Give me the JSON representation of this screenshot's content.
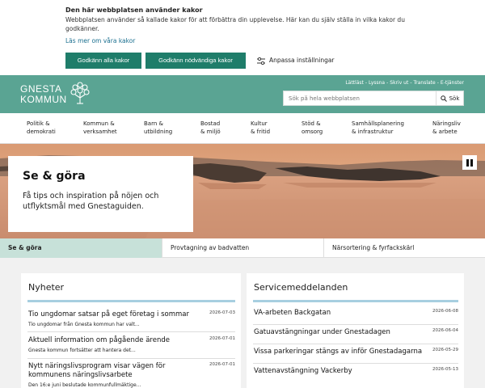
{
  "cookie": {
    "title": "Den här webbplatsen använder kakor",
    "description": "Webbplatsen använder så kallade kakor för att förbättra din upplevelse. Här kan du själv ställa in vilka kakor du godkänner.",
    "read_more": "Läs mer om våra kakor",
    "accept_all": "Godkänn alla kakor",
    "accept_necessary": "Godkänn nödvändiga kakor",
    "settings": "Anpassa inställningar"
  },
  "header": {
    "logo_line1": "GNESTA",
    "logo_line2": "KOMMUN",
    "top_links": [
      "Lättläst",
      "Lyssna",
      "Skriv ut",
      "Translate",
      "E-tjänster"
    ],
    "top_sep": "-",
    "search_placeholder": "Sök på hela webbplatsen",
    "search_button": "Sök"
  },
  "nav": [
    {
      "line1": "Politik &",
      "line2": "demokrati"
    },
    {
      "line1": "Kommun &",
      "line2": "verksamhet"
    },
    {
      "line1": "Barn &",
      "line2": "utbildning"
    },
    {
      "line1": "Bostad",
      "line2": "& miljö"
    },
    {
      "line1": "Kultur",
      "line2": "& fritid"
    },
    {
      "line1": "Stöd &",
      "line2": "omsorg"
    },
    {
      "line1": "Samhällsplanering",
      "line2": "& infrastruktur"
    },
    {
      "line1": "Näringsliv",
      "line2": "& arbete"
    }
  ],
  "hero": {
    "title": "Se & göra",
    "text": "Få tips och inspiration på nöjen och utflyktsmål med Gnestaguiden."
  },
  "subnav": [
    "Se & göra",
    "Provtagning av badvatten",
    "Närsortering & fyrfackskärl"
  ],
  "news": {
    "title": "Nyheter",
    "items": [
      {
        "title": "Tio ungdomar satsar på eget företag i sommar",
        "date": "2026-07-03",
        "summary": "Tio ungdomar från Gnesta kommun har valt..."
      },
      {
        "title": "Aktuell information om pågående ärende",
        "date": "2026-07-01",
        "summary": "Gnesta kommun fortsätter att hantera det..."
      },
      {
        "title": "Nytt näringslivsprogram visar vägen för kommunens näringslivsarbete",
        "date": "2026-07-01",
        "summary": "Den 16:e juni beslutade kommunfullmäktige..."
      }
    ]
  },
  "service": {
    "title": "Servicemeddelanden",
    "items": [
      {
        "title": "VA-arbeten Backgatan",
        "date": "2026-06-08"
      },
      {
        "title": "Gatuavstängningar under Gnestadagen",
        "date": "2026-06-04"
      },
      {
        "title": "Vissa parkeringar stängs av inför Gnestadagarna",
        "date": "2026-05-29"
      },
      {
        "title": "Vattenavstängning Vackerby",
        "date": "2026-05-13"
      }
    ]
  },
  "colors": {
    "accent": "#5aa493",
    "button": "#1f7d6a",
    "active_tab": "#c7e1d9",
    "link": "#1a6f8f"
  }
}
